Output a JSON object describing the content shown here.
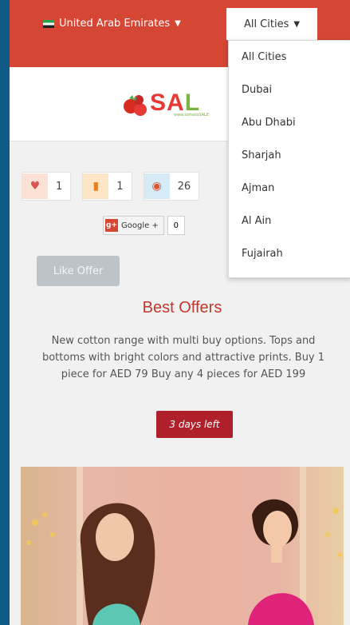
{
  "header": {
    "country_label": "United Arab Emirates",
    "city_select_label": "All Cities"
  },
  "city_dropdown": {
    "options": [
      "All Cities",
      "Dubai",
      "Abu Dhabi",
      "Sharjah",
      "Ajman",
      "Al Ain",
      "Fujairah"
    ]
  },
  "logo": {
    "text_red": "SA",
    "text_green": "L",
    "tagline": "www.tomatoSALE"
  },
  "counters": {
    "likes": "1",
    "comments": "1",
    "views": "26"
  },
  "share": {
    "google_label": "Google +",
    "google_count": "0"
  },
  "offer": {
    "like_button": "Like Offer",
    "title": "Best Offers",
    "description": "New cotton range with multi buy options. Tops and bottoms with bright colors and attractive prints. Buy 1 piece for AED 79 Buy any 4 pieces for AED 199",
    "days_left": "3 days left"
  },
  "colors": {
    "brand_red": "#d64635",
    "accent_dark_red": "#b0202a",
    "page_border_blue": "#0f5a86"
  }
}
